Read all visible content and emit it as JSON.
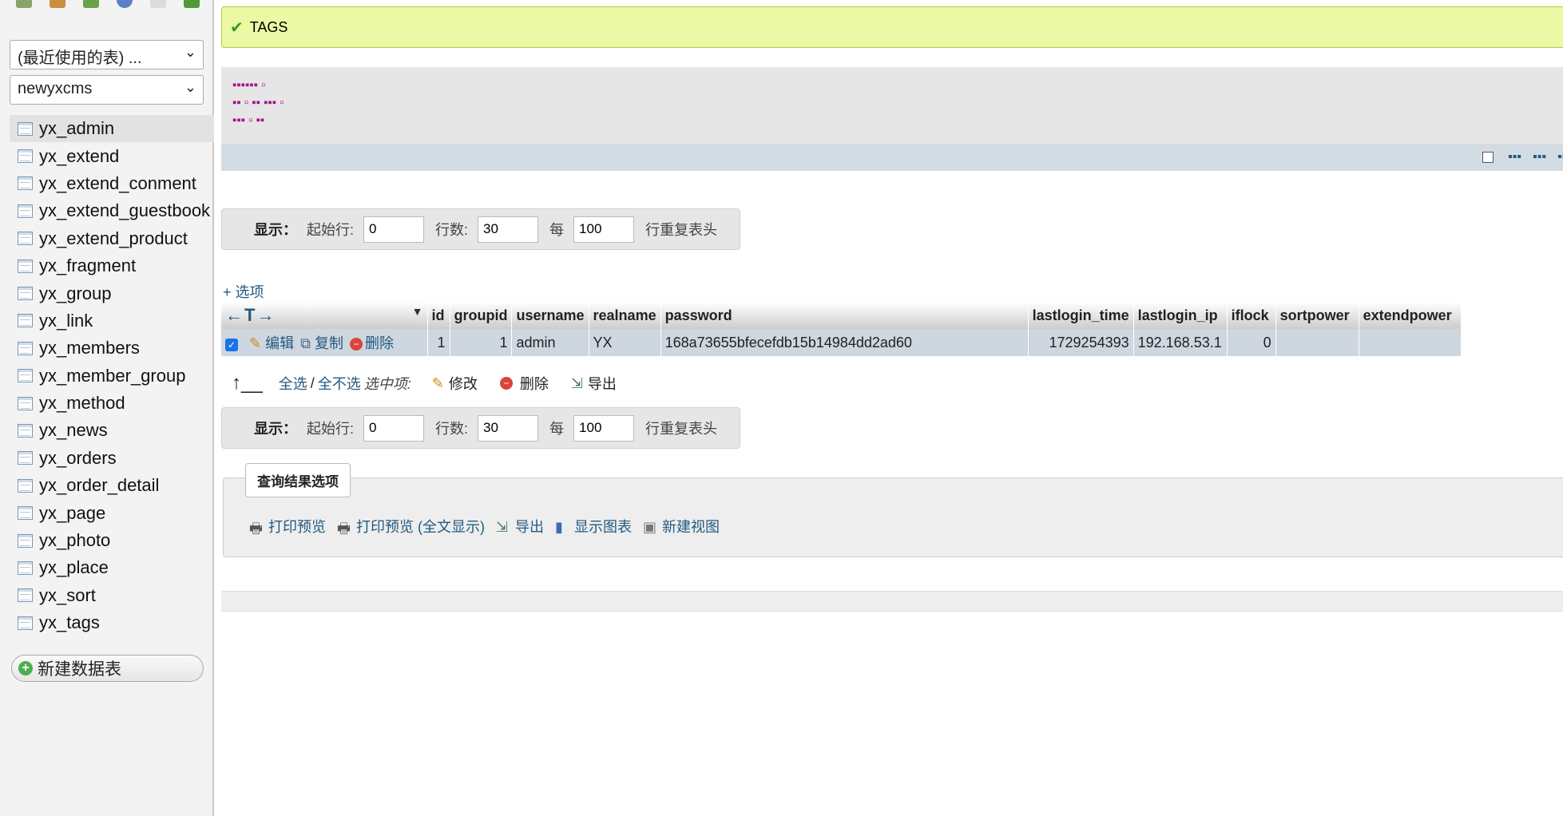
{
  "sidebar": {
    "recent_tables": "(最近使用的表) ...",
    "database": "newyxcms",
    "tables": [
      "yx_admin",
      "yx_extend",
      "yx_extend_conment",
      "yx_extend_guestbook",
      "yx_extend_product",
      "yx_fragment",
      "yx_group",
      "yx_link",
      "yx_members",
      "yx_member_group",
      "yx_method",
      "yx_news",
      "yx_orders",
      "yx_order_detail",
      "yx_page",
      "yx_photo",
      "yx_place",
      "yx_sort",
      "yx_tags"
    ],
    "active_table": "yx_admin",
    "new_table": "新建数据表"
  },
  "nav_bar": {
    "show_label": "显示：",
    "start_row_label": "起始行:",
    "start_row": "0",
    "rows_label": "行数:",
    "rows": "30",
    "every_label": "每",
    "repeat": "100",
    "repeat_header_label": "行重复表头"
  },
  "options_link": "+ 选项",
  "results": {
    "columns": [
      "id",
      "groupid",
      "username",
      "realname",
      "password",
      "lastlogin_time",
      "lastlogin_ip",
      "iflock",
      "sortpower",
      "extendpower"
    ],
    "rows": [
      {
        "id": "1",
        "groupid": "1",
        "username": "admin",
        "realname": "YX",
        "password": "168a73655bfecefdb15b14984dd2ad60",
        "lastlogin_time": "1729254393",
        "lastlogin_ip": "192.168.53.1",
        "iflock": "0",
        "sortpower": "",
        "extendpower": ""
      }
    ],
    "actions": {
      "edit": "编辑",
      "copy": "复制",
      "delete": "删除"
    }
  },
  "bulk": {
    "select_all": "全选",
    "separator": "/",
    "deselect_all": "全不选",
    "with_selected": "选中项:",
    "modify": "修改",
    "delete": "删除",
    "export": "导出"
  },
  "query_ops": {
    "legend": "查询结果选项",
    "print_preview": "打印预览",
    "print_preview_full": "打印预览 (全文显示)",
    "export": "导出",
    "display_chart": "显示图表",
    "create_view": "新建视图"
  },
  "colors": {
    "link": "#235a81",
    "success_bg": "#ebf8a4",
    "row_bg": "#ced6df"
  }
}
